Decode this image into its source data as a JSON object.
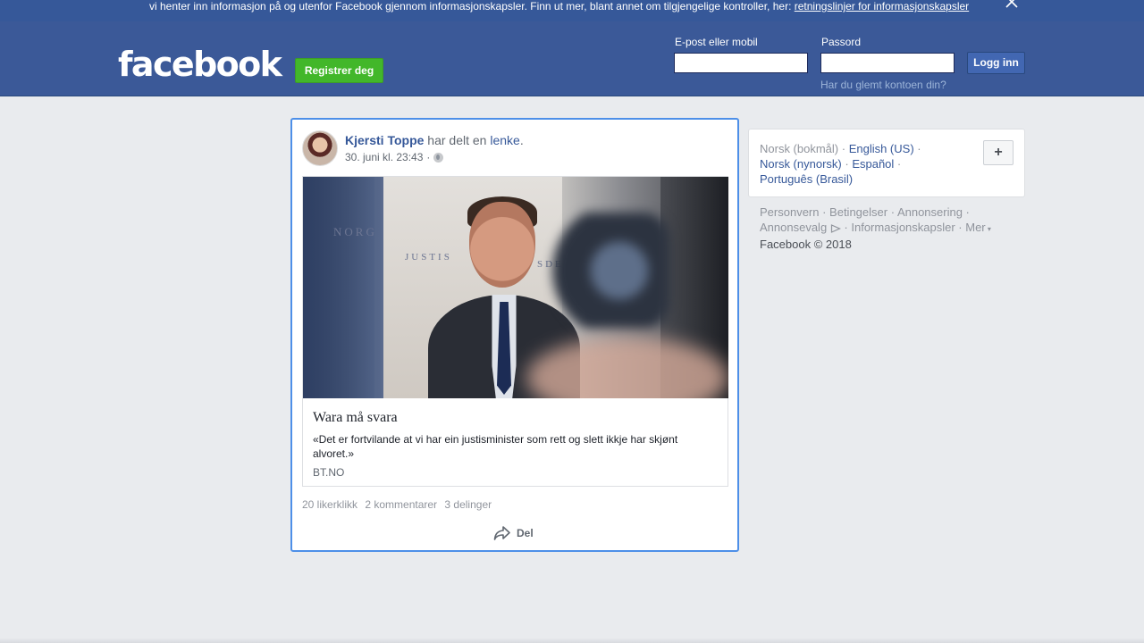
{
  "cookie_banner": {
    "text": "vi henter inn informasjon på og utenfor Facebook gjennom informasjonskapsler. Finn ut mer, blant annet om tilgjengelige kontroller, her: ",
    "link": "retningslinjer for informasjonskapsler"
  },
  "header": {
    "logo": "facebook",
    "register_label": "Registrer deg",
    "email_label": "E-post eller mobil",
    "email_value": "",
    "password_label": "Passord",
    "password_value": "",
    "login_label": "Logg inn",
    "forgot_label": "Har du glemt kontoen din?"
  },
  "post": {
    "author": "Kjersti Toppe",
    "action": " har delt en ",
    "action_link": "lenke",
    "action_end": ".",
    "timestamp": "30. juni kl. 23:43",
    "meta_sep": "·",
    "preview": {
      "image_sign_1": "NORG",
      "image_sign_2": "JUSTIS",
      "image_sign_3": "SDE",
      "title": "Wara må svara",
      "description": "«Det er fortvilande at vi har ein justisminister som rett og slett ikkje har skjønt alvoret.»",
      "domain": "BT.NO"
    },
    "stats": {
      "likes": "20 likerklikk",
      "comments": "2 kommentarer",
      "shares": "3 delinger"
    },
    "share_label": "Del"
  },
  "languages": {
    "current": "Norsk (bokmål)",
    "options": [
      "English (US)",
      "Norsk (nynorsk)",
      "Español",
      "Português (Brasil)"
    ],
    "add_label": "+"
  },
  "footer": {
    "links": [
      "Personvern",
      "Betingelser",
      "Annonsering",
      "Annonsevalg",
      "Informasjonskapsler",
      "Mer"
    ],
    "copyright": "Facebook © 2018"
  },
  "colors": {
    "brand": "#3b5998",
    "link": "#365899",
    "register": "#42b72a",
    "focus_border": "#4d8fe8"
  }
}
